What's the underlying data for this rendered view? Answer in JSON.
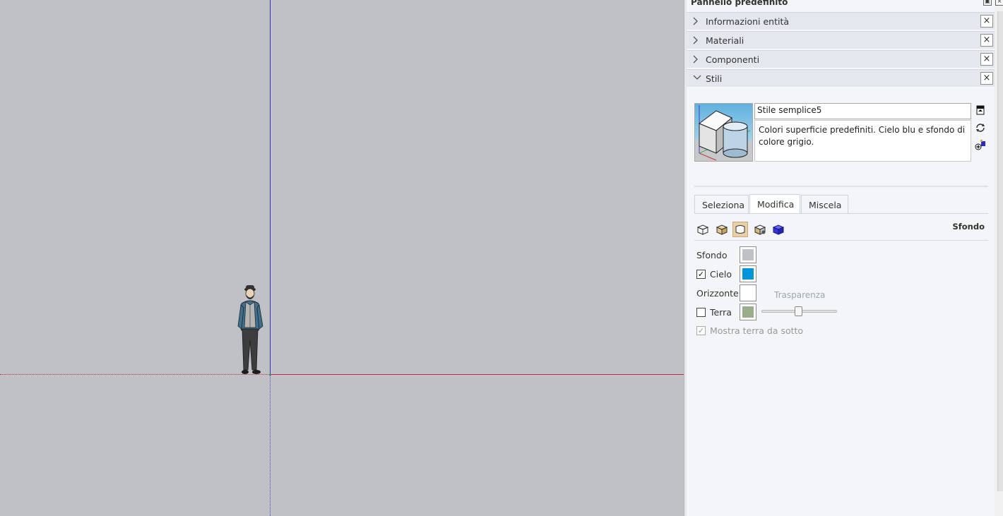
{
  "panel": {
    "title": "Pannello predefinito"
  },
  "trays": [
    {
      "label": "Informazioni entità",
      "expanded": false
    },
    {
      "label": "Materiali",
      "expanded": false
    },
    {
      "label": "Componenti",
      "expanded": false
    },
    {
      "label": "Stili",
      "expanded": true
    }
  ],
  "style": {
    "name": "Stile semplice5",
    "description": "Colori superficie predefiniti. Cielo blu e sfondo di colore grigio."
  },
  "tabs": [
    {
      "label": "Seleziona",
      "active": false
    },
    {
      "label": "Modifica",
      "active": true
    },
    {
      "label": "Miscela",
      "active": false
    }
  ],
  "edit": {
    "section_label": "Sfondo",
    "mode_icons": [
      "edge-settings-icon",
      "face-settings-icon",
      "background-settings-icon",
      "watermark-settings-icon",
      "modeling-settings-icon"
    ],
    "rows": {
      "sfondo": {
        "label": "Sfondo",
        "color": "#c0c1c6"
      },
      "cielo": {
        "label": "Cielo",
        "checked": true,
        "color": "#0095d9"
      },
      "orizzonte": {
        "label": "Orizzonte",
        "color": "#ffffff"
      },
      "terra": {
        "label": "Terra",
        "checked": false,
        "color": "#9aae8c"
      },
      "transparency_label": "Trasparenza",
      "transparency_value": 0.5,
      "show_ground_below": {
        "label": "Mostra terra da sotto",
        "checked": true,
        "disabled": true
      }
    }
  },
  "viewport": {
    "background": "#c0c1c6"
  }
}
